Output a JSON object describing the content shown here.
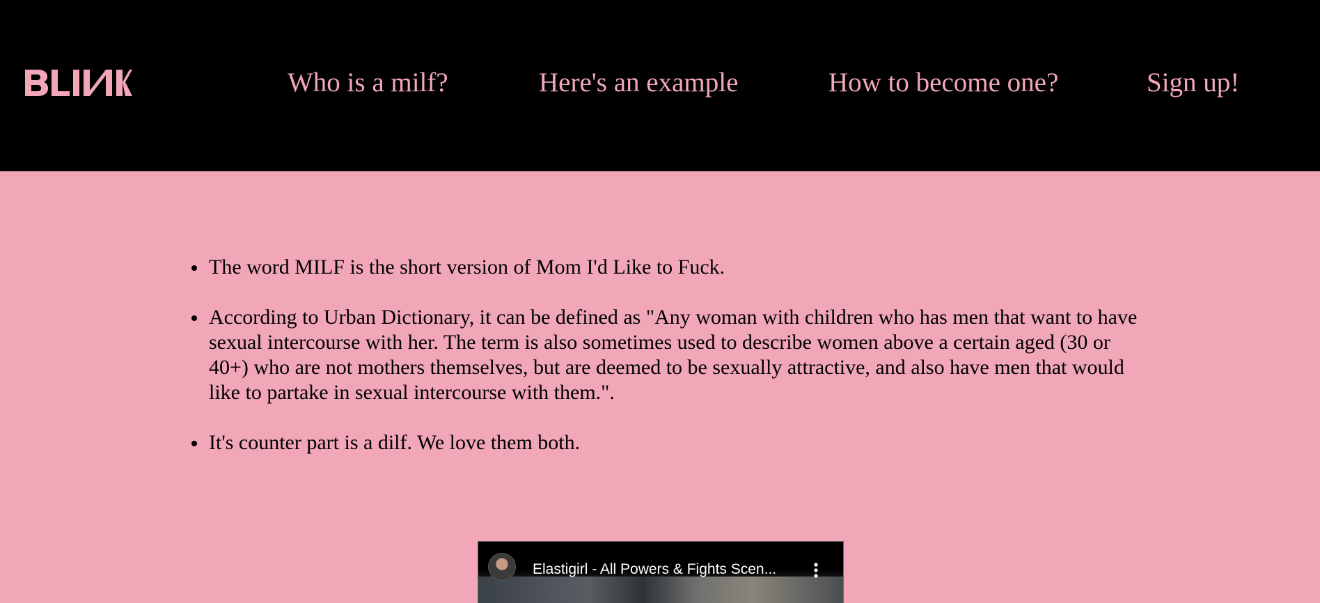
{
  "header": {
    "logo_text": "BLINK",
    "nav": [
      {
        "label": "Who is a milf?"
      },
      {
        "label": "Here's an example"
      },
      {
        "label": "How to become one?"
      },
      {
        "label": "Sign up!"
      }
    ]
  },
  "main": {
    "facts": [
      "The word MILF is the short version of Mom I'd Like to Fuck.",
      "According to Urban Dictionary, it can be defined as \"Any woman with children who has men that want to have sexual intercourse with her. The term is also sometimes used to describe women above a certain aged (30 or 40+) who are not mothers themselves, but are deemed to be sexually attractive, and also have men that would like to partake in sexual intercourse with them.\".",
      "It's counter part is a dilf. We love them both."
    ]
  },
  "video": {
    "title": "Elastigirl - All Powers & Fights Scen...",
    "avatar_icon": "channel-avatar",
    "menu_icon": "more-vertical-icon"
  },
  "colors": {
    "header_bg": "#000000",
    "page_bg": "#f2a7b9",
    "accent_pink": "#f2a7b9",
    "text": "#000000"
  }
}
